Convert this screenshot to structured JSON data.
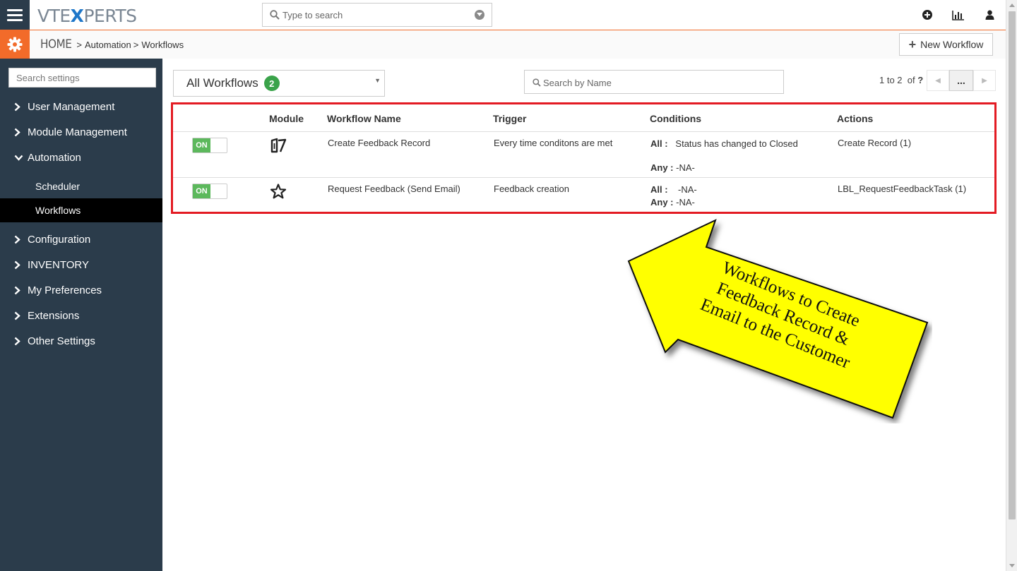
{
  "header": {
    "logo_left": "VTE",
    "logo_x": "X",
    "logo_right": "PERTS",
    "search_placeholder": "Type to search",
    "icons": [
      "menu-icon",
      "plus-circle-icon",
      "bar-chart-icon",
      "user-icon"
    ]
  },
  "subheader": {
    "home": "HOME",
    "crumb1": "Automation",
    "crumb2": "Workflows",
    "new_workflow": "New Workflow"
  },
  "sidebar": {
    "search_placeholder": "Search settings",
    "items": [
      {
        "label": "User Management"
      },
      {
        "label": "Module Management"
      },
      {
        "label": "Automation",
        "expanded": true,
        "children": [
          {
            "label": "Scheduler"
          },
          {
            "label": "Workflows",
            "active": true
          }
        ]
      },
      {
        "label": "Configuration"
      },
      {
        "label": "INVENTORY"
      },
      {
        "label": "My Preferences"
      },
      {
        "label": "Extensions"
      },
      {
        "label": "Other Settings"
      }
    ]
  },
  "toolbar": {
    "filter_label": "All Workflows",
    "filter_count": "2",
    "name_search_placeholder": "Search by Name",
    "pager_range": "1 to 2",
    "pager_of": "of",
    "pager_total": "?",
    "pager_more": "..."
  },
  "table": {
    "columns": [
      "Module",
      "Workflow Name",
      "Trigger",
      "Conditions",
      "Actions"
    ],
    "rows": [
      {
        "status": "ON",
        "module_icon": "feedback-module-icon",
        "name": "Create Feedback Record",
        "trigger": "Every time conditons are met",
        "all_label": "All :",
        "all_value": "Status has changed to Closed",
        "any_label": "Any :",
        "any_value": "-NA-",
        "action": "Create Record (1)"
      },
      {
        "status": "ON",
        "module_icon": "star-icon",
        "name": "Request Feedback (Send Email)",
        "trigger": "Feedback creation",
        "all_label": "All :",
        "all_value": "-NA-",
        "any_label": "Any :",
        "any_value": "-NA-",
        "action": "LBL_RequestFeedbackTask (1)"
      }
    ]
  },
  "annotation": {
    "line1": "Workflows to Create",
    "line2": "Feedback Record &",
    "line3": "Email to the Customer",
    "fill_color": "#ffff00"
  },
  "colors": {
    "brand_orange": "#f26b2a",
    "sidebar_bg": "#2b3c4b",
    "highlight_red": "#e31b23",
    "toggle_green": "#5cb85c",
    "badge_green": "#3aa34a"
  }
}
